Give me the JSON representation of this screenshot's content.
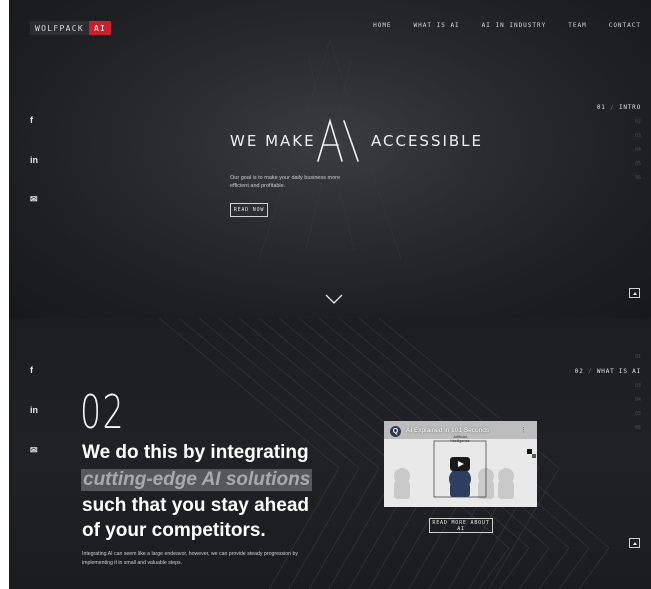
{
  "brand": {
    "name": "WOLFPACK",
    "badge": "AI",
    "accent": "#c8202f"
  },
  "nav": {
    "items": [
      "HOME",
      "WHAT IS AI",
      "AI IN INDUSTRY",
      "TEAM",
      "CONTACT"
    ]
  },
  "social": {
    "facebook": "f",
    "linkedin": "in",
    "email": "✉"
  },
  "hero": {
    "headline_left": "WE MAKE",
    "headline_logo": "AI",
    "headline_right": "ACCESSIBLE",
    "intro": "Our goal is to make your daily business more efficient and profitable.",
    "cta": "READ NOW"
  },
  "pager1": {
    "current": "01",
    "label": "INTRO",
    "dots": [
      "02",
      "03",
      "04",
      "05",
      "06"
    ]
  },
  "section2": {
    "number": "02",
    "lines": [
      "We do this by integrating",
      "cutting-edge AI solutions",
      "such that you stay ahead",
      "of your competitors."
    ],
    "body": "Integrating AI can seem like a large endeavor, however, we can provide steady progression by implementing it in small and valuable steps.",
    "cta": "READ MORE ABOUT AI"
  },
  "pager2": {
    "current": "02",
    "label": "WHAT IS AI",
    "dots_before": [
      "01"
    ],
    "dots_after": [
      "03",
      "04",
      "05",
      "06"
    ]
  },
  "video": {
    "channel_icon": "Q",
    "title": "AI Explained in 101 Seconds",
    "menu": "⋮",
    "diagram_label": "Artificial Intelligence"
  },
  "colors": {
    "bg_dark": "#1e1f23",
    "text": "#eeeeee",
    "highlight": "#55575c"
  },
  "icons": {
    "chevron": "chevron-down-icon",
    "scroll": "arrow-up-icon"
  }
}
